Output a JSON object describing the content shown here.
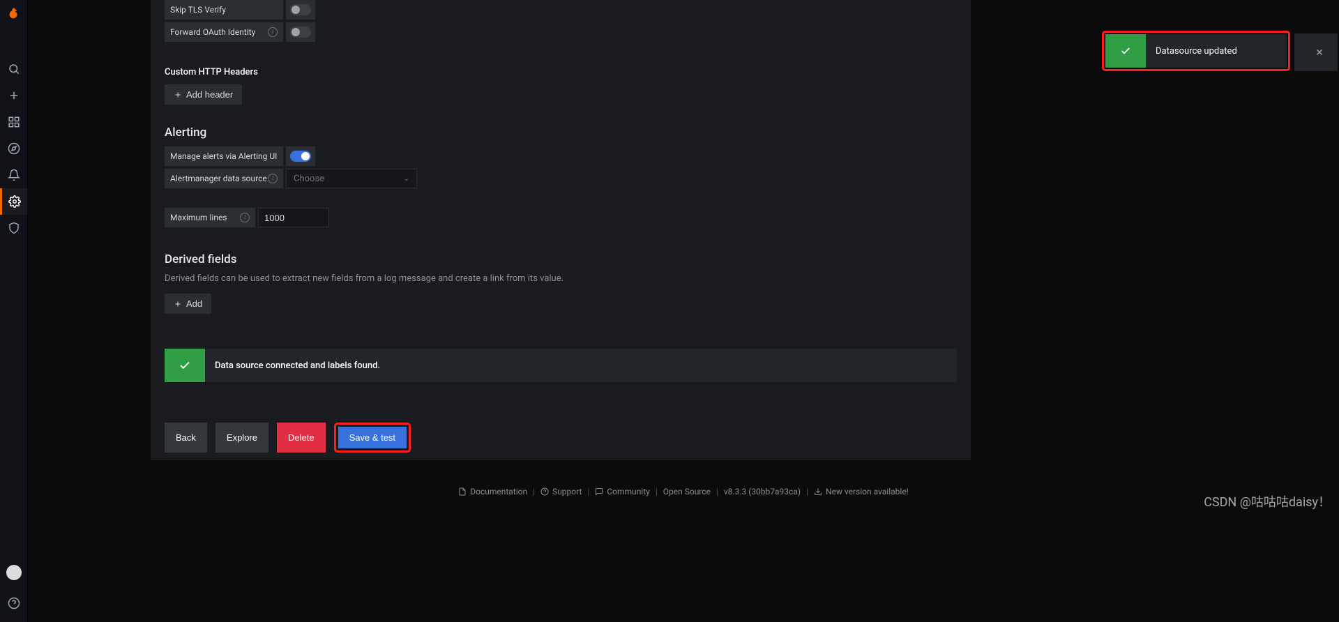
{
  "sidebar": {
    "items": [
      {
        "name": "search"
      },
      {
        "name": "create"
      },
      {
        "name": "dashboards"
      },
      {
        "name": "explore"
      },
      {
        "name": "alerting"
      },
      {
        "name": "configuration"
      },
      {
        "name": "server-admin"
      }
    ]
  },
  "form": {
    "skip_tls_verify": {
      "label": "Skip TLS Verify",
      "on": false
    },
    "forward_oauth": {
      "label": "Forward OAuth Identity",
      "on": false
    },
    "custom_headers_title": "Custom HTTP Headers",
    "add_header_label": "Add header",
    "alerting_title": "Alerting",
    "manage_alerts": {
      "label": "Manage alerts via Alerting UI",
      "on": true
    },
    "alertmanager_ds": {
      "label": "Alertmanager data source",
      "placeholder": "Choose"
    },
    "maximum_lines": {
      "label": "Maximum lines",
      "value": "1000"
    },
    "derived_fields_title": "Derived fields",
    "derived_fields_help": "Derived fields can be used to extract new fields from a log message and create a link from its value.",
    "add_label": "Add"
  },
  "status": {
    "message": "Data source connected and labels found."
  },
  "buttons": {
    "back": "Back",
    "explore": "Explore",
    "delete": "Delete",
    "save_test": "Save & test"
  },
  "toast": {
    "message": "Datasource updated"
  },
  "footer": {
    "documentation": "Documentation",
    "support": "Support",
    "community": "Community",
    "open_source": "Open Source",
    "version": "v8.3.3 (30bb7a93ca)",
    "new_version": "New version available!"
  },
  "watermark": "CSDN @咕咕咕daisy！"
}
